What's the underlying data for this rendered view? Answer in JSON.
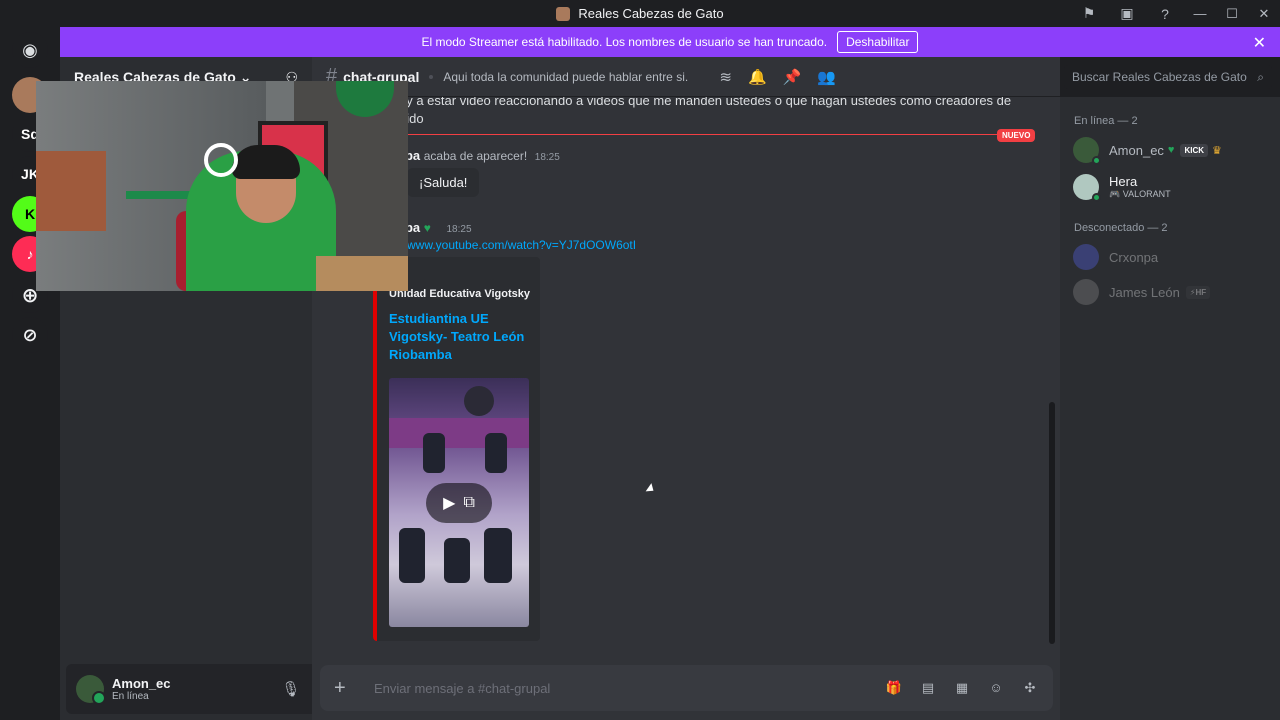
{
  "window": {
    "title": "Reales Cabezas de Gato"
  },
  "guilds": [
    "Sd",
    "JK"
  ],
  "banner": {
    "text": "El modo Streamer está habilitado. Los nombres de usuario se han truncado.",
    "button": "Deshabilitar"
  },
  "server": {
    "name": "Reales Cabezas de Gato"
  },
  "user": {
    "name": "Amon_ec",
    "status": "En línea"
  },
  "channel": {
    "name": "chat-grupal",
    "topic": "Aqui toda la comunidad puede hablar entre si."
  },
  "search": {
    "placeholder": "Buscar Reales Cabezas de Gato"
  },
  "chat": {
    "line1": "oy a estar video reaccionando a videos que me manden ustedes o que hagan ustedes como creadores de",
    "line2": "nido",
    "new_badge": "NUEVO",
    "join_author": "npa",
    "join_text": "acaba de aparecer!",
    "join_time": "18:25",
    "greet_button": "¡Saluda!",
    "msg_author": "npa",
    "msg_time": "18:25",
    "link": "://www.youtube.com/watch?v=YJ7dOOW6otI",
    "embed": {
      "provider": "ube",
      "channel": "Unidad Educativa Vigotsky",
      "title": "Estudiantina UE Vigotsky- Teatro León Riobamba"
    }
  },
  "composer": {
    "placeholder": "Enviar mensaje a #chat-grupal"
  },
  "members": {
    "online_header": "En línea — 2",
    "offline_header": "Desconectado — 2",
    "online": [
      {
        "name": "Amon_ec",
        "badge": "KICK",
        "activity": ""
      },
      {
        "name": "Hera",
        "badge": "",
        "activity": "VALORANT"
      }
    ],
    "offline": [
      {
        "name": "Crxonpa",
        "badge": ""
      },
      {
        "name": "James León",
        "badge": "HF"
      }
    ]
  }
}
